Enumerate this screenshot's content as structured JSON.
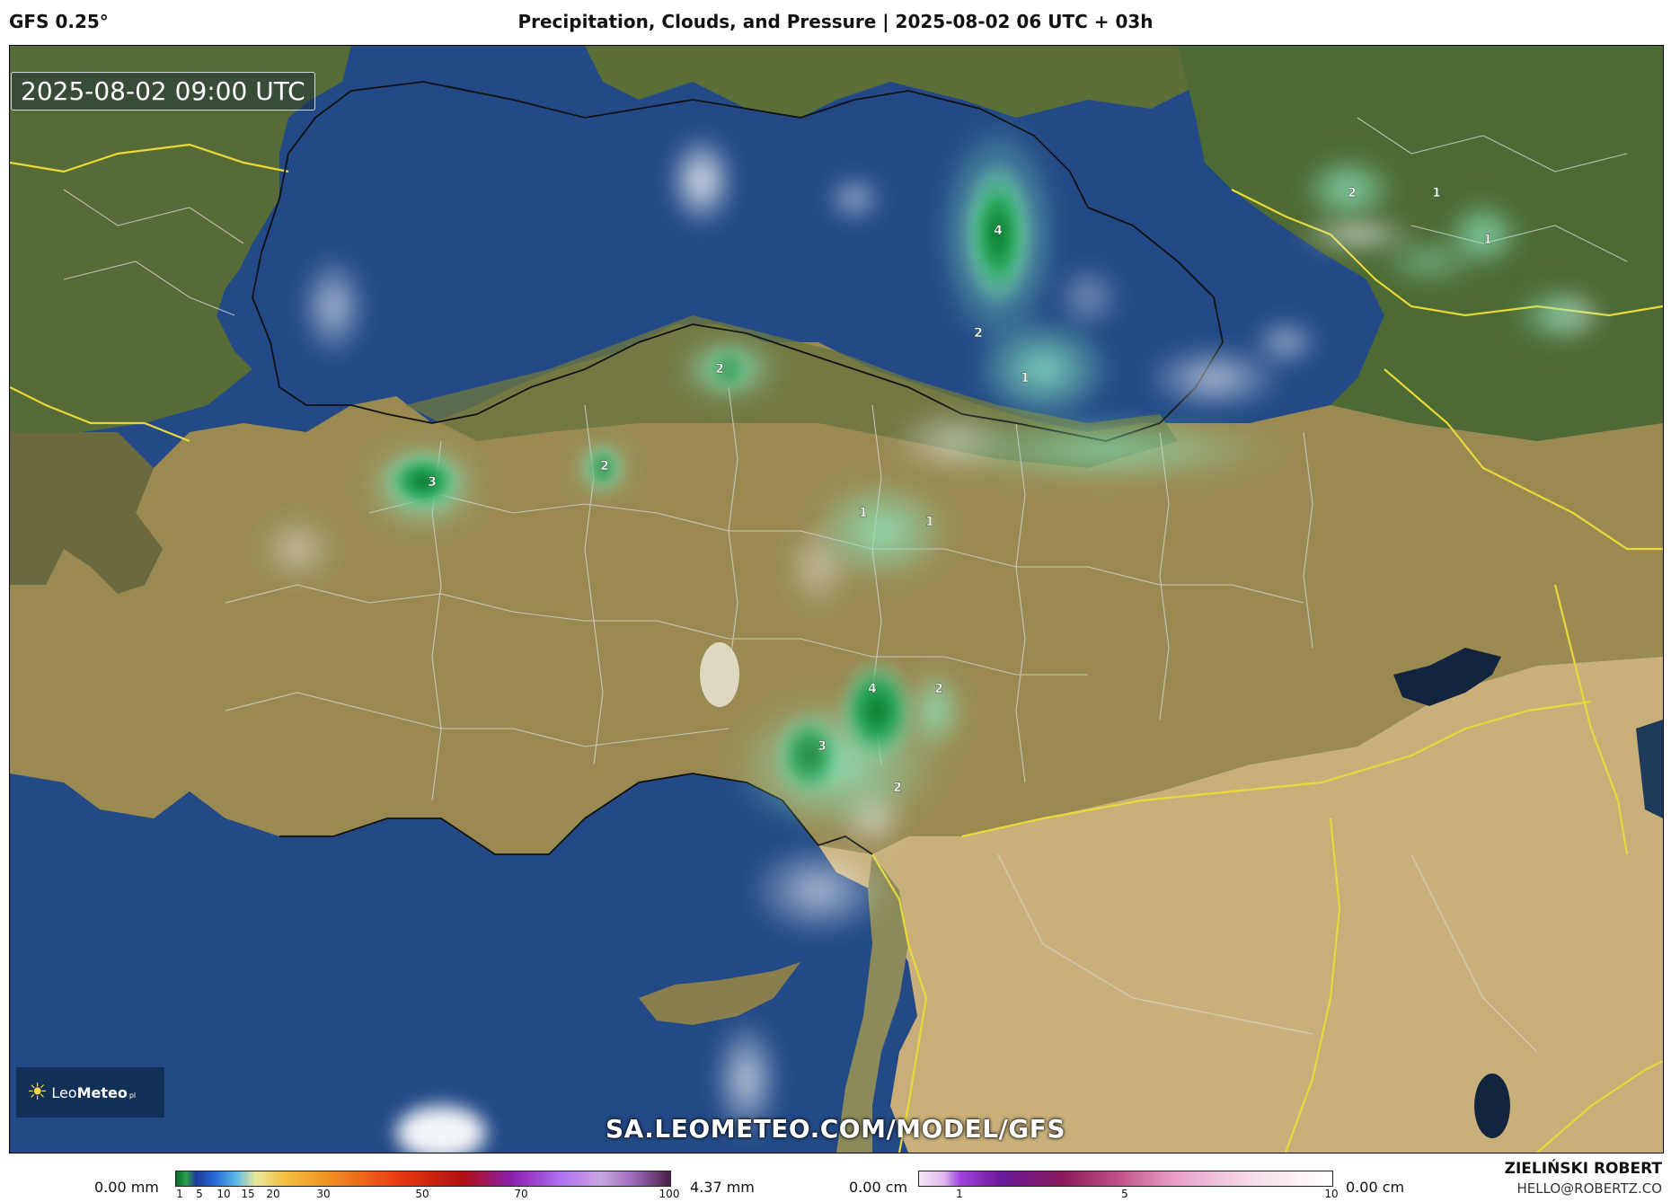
{
  "header": {
    "model": "GFS 0.25°",
    "title": "Precipitation, Clouds, and Pressure | 2025-08-02 06 UTC + 03h"
  },
  "map": {
    "timestamp": "2025-08-02 09:00 UTC",
    "watermark": "SA.LEOMETEO.COM/MODEL/GFS",
    "logo": {
      "brand_a": "Leo",
      "brand_b": "Meteo",
      "suffix": "pl"
    },
    "precip_labels": [
      "4",
      "2",
      "1",
      "2",
      "1",
      "1",
      "2",
      "3",
      "2",
      "1",
      "1",
      "4",
      "2",
      "3",
      "2"
    ],
    "colors": {
      "sea": "#234a86",
      "land": "#9a8a52",
      "desert": "#c9b07a",
      "vegetation": "#4d6a34",
      "border_country": "#e8d83a",
      "border_province": "#d9d9d9",
      "precip_light": "#7fe3b6",
      "precip_heavy": "#0a7a2a"
    }
  },
  "legend_precip": {
    "min_label": "0.00 mm",
    "max_label": "4.37 mm",
    "ticks": [
      "1",
      "5",
      "10",
      "15",
      "20",
      "30",
      "50",
      "70",
      "100"
    ]
  },
  "legend_snow": {
    "min_label": "0.00 cm",
    "max_label": "0.00 cm",
    "ticks": [
      "1",
      "5",
      "10"
    ]
  },
  "credits": {
    "author": "ZIELIŃSKI ROBERT",
    "email": "HELLO@ROBERTZ.CO"
  }
}
